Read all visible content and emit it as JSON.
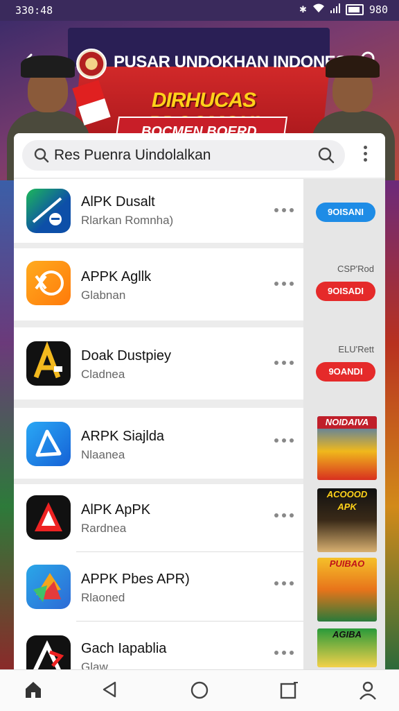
{
  "status_bar": {
    "time": "330:48",
    "battery_text": "980"
  },
  "header": {
    "title": "PUSAR UNDOKHAN INDONESIA",
    "banner_headline": "DIRHUCAS PDOOMGH!",
    "banner_subline": "BOCMEN BOERD NADLOAH"
  },
  "search": {
    "query": "Res Puenra Uindolalkan"
  },
  "apps": [
    {
      "name": "AlPK Dusalt",
      "subtitle": "Rlarkan  Romnha)"
    },
    {
      "name": "APPK Agllk",
      "subtitle": "Glabnan"
    },
    {
      "name": "Doak Dustpiey",
      "subtitle": "Cladnea"
    },
    {
      "name": "ARPK Siajlda",
      "subtitle": "Nlaanea"
    },
    {
      "name": "AlPK ApPK",
      "subtitle": "Rardnea"
    },
    {
      "name": "APPK Pbes APR)",
      "subtitle": "Rlaoned"
    },
    {
      "name": "Gach Iapablia",
      "subtitle": "Glaw"
    }
  ],
  "right_column": {
    "pills": [
      "9OISANI",
      "9OISADI",
      "9OANDI"
    ],
    "prices": [
      "CSP'Rod",
      "ELU'Rett"
    ],
    "thumb_titles": [
      "NOIDAIVA",
      "ACOOOD APK",
      "PUIBAO",
      "AGIBA"
    ]
  },
  "colors": {
    "pill_blue": "#1e8ce6",
    "pill_red": "#e52a2a",
    "banner_yellow": "#ffd21a"
  },
  "nav": {
    "icons": [
      "home-icon",
      "back-triangle-icon",
      "circle-home-icon",
      "recents-square-icon",
      "profile-icon"
    ]
  }
}
